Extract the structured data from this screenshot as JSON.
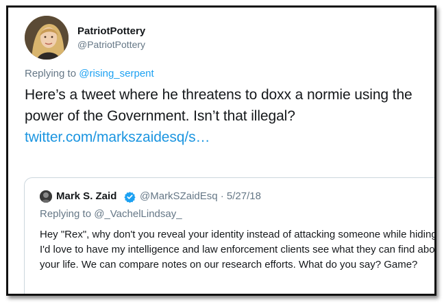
{
  "tweet": {
    "display_name": "PatriotPottery",
    "handle": "@PatriotPottery",
    "replying_prefix": "Replying to ",
    "replying_to": "@rising_serpent",
    "text": "Here’s a tweet where he threatens to doxx a normie using the power of the Government. Isn’t that illegal? ",
    "link_text": "twitter.com/markszaidesq/s…"
  },
  "quoted_tweet": {
    "display_name": "Mark S. Zaid",
    "handle_date": "@MarkSZaidEsq · 5/27/18",
    "replying_prefix": "Replying to ",
    "replying_to": "@_VachelLindsay_",
    "text": "Hey \"Rex\", why don't you reveal your identity instead of attacking someone while hiding? I'd love to have my intelligence and law enforcement clients see what they can find about your life. We can compare notes on our research efforts. What do you say? Game?"
  },
  "colors": {
    "link": "#1b95e0",
    "muted": "#657786",
    "text": "#14171a",
    "verified": "#1da1f2"
  }
}
